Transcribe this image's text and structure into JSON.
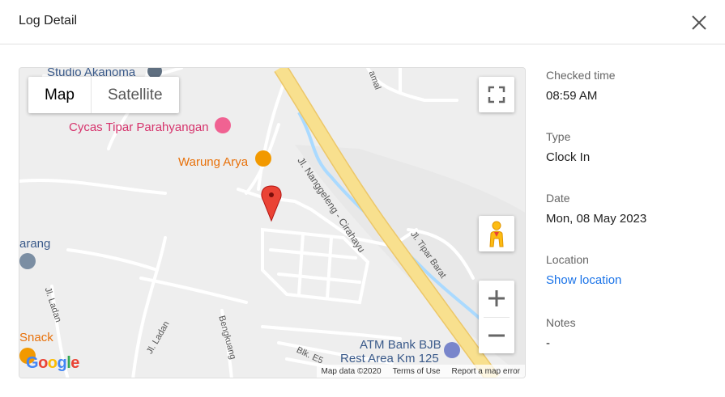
{
  "dialog": {
    "title": "Log Detail"
  },
  "map": {
    "type_controls": {
      "map": "Map",
      "satellite": "Satellite"
    },
    "places": {
      "studio": "Studio Akanoma",
      "cycas": "Cycas Tipar Parahyangan",
      "warung": "Warung Arya",
      "arang": "arang",
      "snack": "Snack",
      "atm_line1": "ATM Bank BJB",
      "atm_line2": "Rest Area Km 125"
    },
    "streets": {
      "nanggeleng": "Jl. Nanggeleng - Cirahayu",
      "tipar_barat": "Jl. Tipar Barat",
      "ladang1": "Jl. Ladan",
      "ladang2": "Jl. Ladan",
      "bengkuang": "Bengkuang",
      "blk": "Blk. E5",
      "amal": "amal"
    },
    "footer": {
      "data": "Map data ©2020",
      "terms": "Terms of Use",
      "report": "Report a map error"
    },
    "logo": [
      "G",
      "o",
      "o",
      "g",
      "l",
      "e"
    ],
    "colors": {
      "highway": "#f8e08e",
      "river": "#aadaff",
      "pin": "#ea4335",
      "road": "#ffffff"
    }
  },
  "details": {
    "checked_time": {
      "label": "Checked time",
      "value": "08:59 AM"
    },
    "type": {
      "label": "Type",
      "value": "Clock In"
    },
    "date": {
      "label": "Date",
      "value": "Mon, 08 May 2023"
    },
    "location": {
      "label": "Location",
      "link": "Show location"
    },
    "notes": {
      "label": "Notes",
      "value": "-"
    }
  }
}
